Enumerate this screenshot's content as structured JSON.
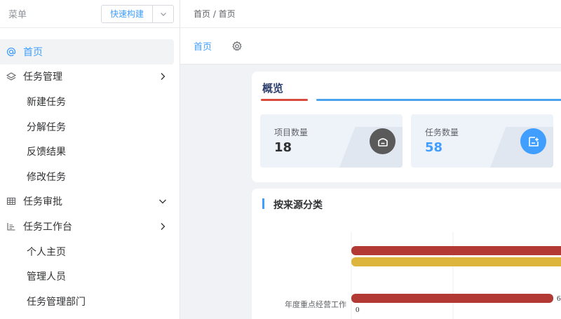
{
  "sidebar": {
    "menu_label": "菜单",
    "quick_build": "快速构建",
    "items": [
      {
        "label": "首页",
        "icon": "at-icon"
      },
      {
        "label": "任务管理",
        "icon": "layers-icon"
      },
      {
        "label": "新建任务"
      },
      {
        "label": "分解任务"
      },
      {
        "label": "反馈结果"
      },
      {
        "label": "修改任务"
      },
      {
        "label": "任务审批",
        "icon": "table-icon"
      },
      {
        "label": "任务工作台",
        "icon": "list-chart-icon"
      },
      {
        "label": "个人主页"
      },
      {
        "label": "管理人员"
      },
      {
        "label": "任务管理部门"
      }
    ]
  },
  "header": {
    "breadcrumb": "首页 / 首页",
    "tab": "首页"
  },
  "overview": {
    "title": "概览",
    "stats": [
      {
        "label": "项目数量",
        "value": "18",
        "color": "#303133",
        "icon_bg": "#5a5a5a"
      },
      {
        "label": "任务数量",
        "value": "58",
        "color": "#409eff",
        "icon_bg": "#409eff"
      }
    ]
  },
  "source": {
    "title": "按来源分类"
  },
  "chart_data": {
    "type": "bar",
    "orientation": "horizontal",
    "categories": [
      "年度重点经营工作"
    ],
    "series": [
      {
        "values": [
          6
        ],
        "color": "#b33a34"
      }
    ],
    "extra_bars": [
      {
        "color": "#b33a34"
      },
      {
        "color": "#ddb53d"
      }
    ],
    "x_tick_first": "0",
    "value_label": "6"
  },
  "colors": {
    "accent": "#409eff",
    "active_bg": "#f2f3f5"
  }
}
